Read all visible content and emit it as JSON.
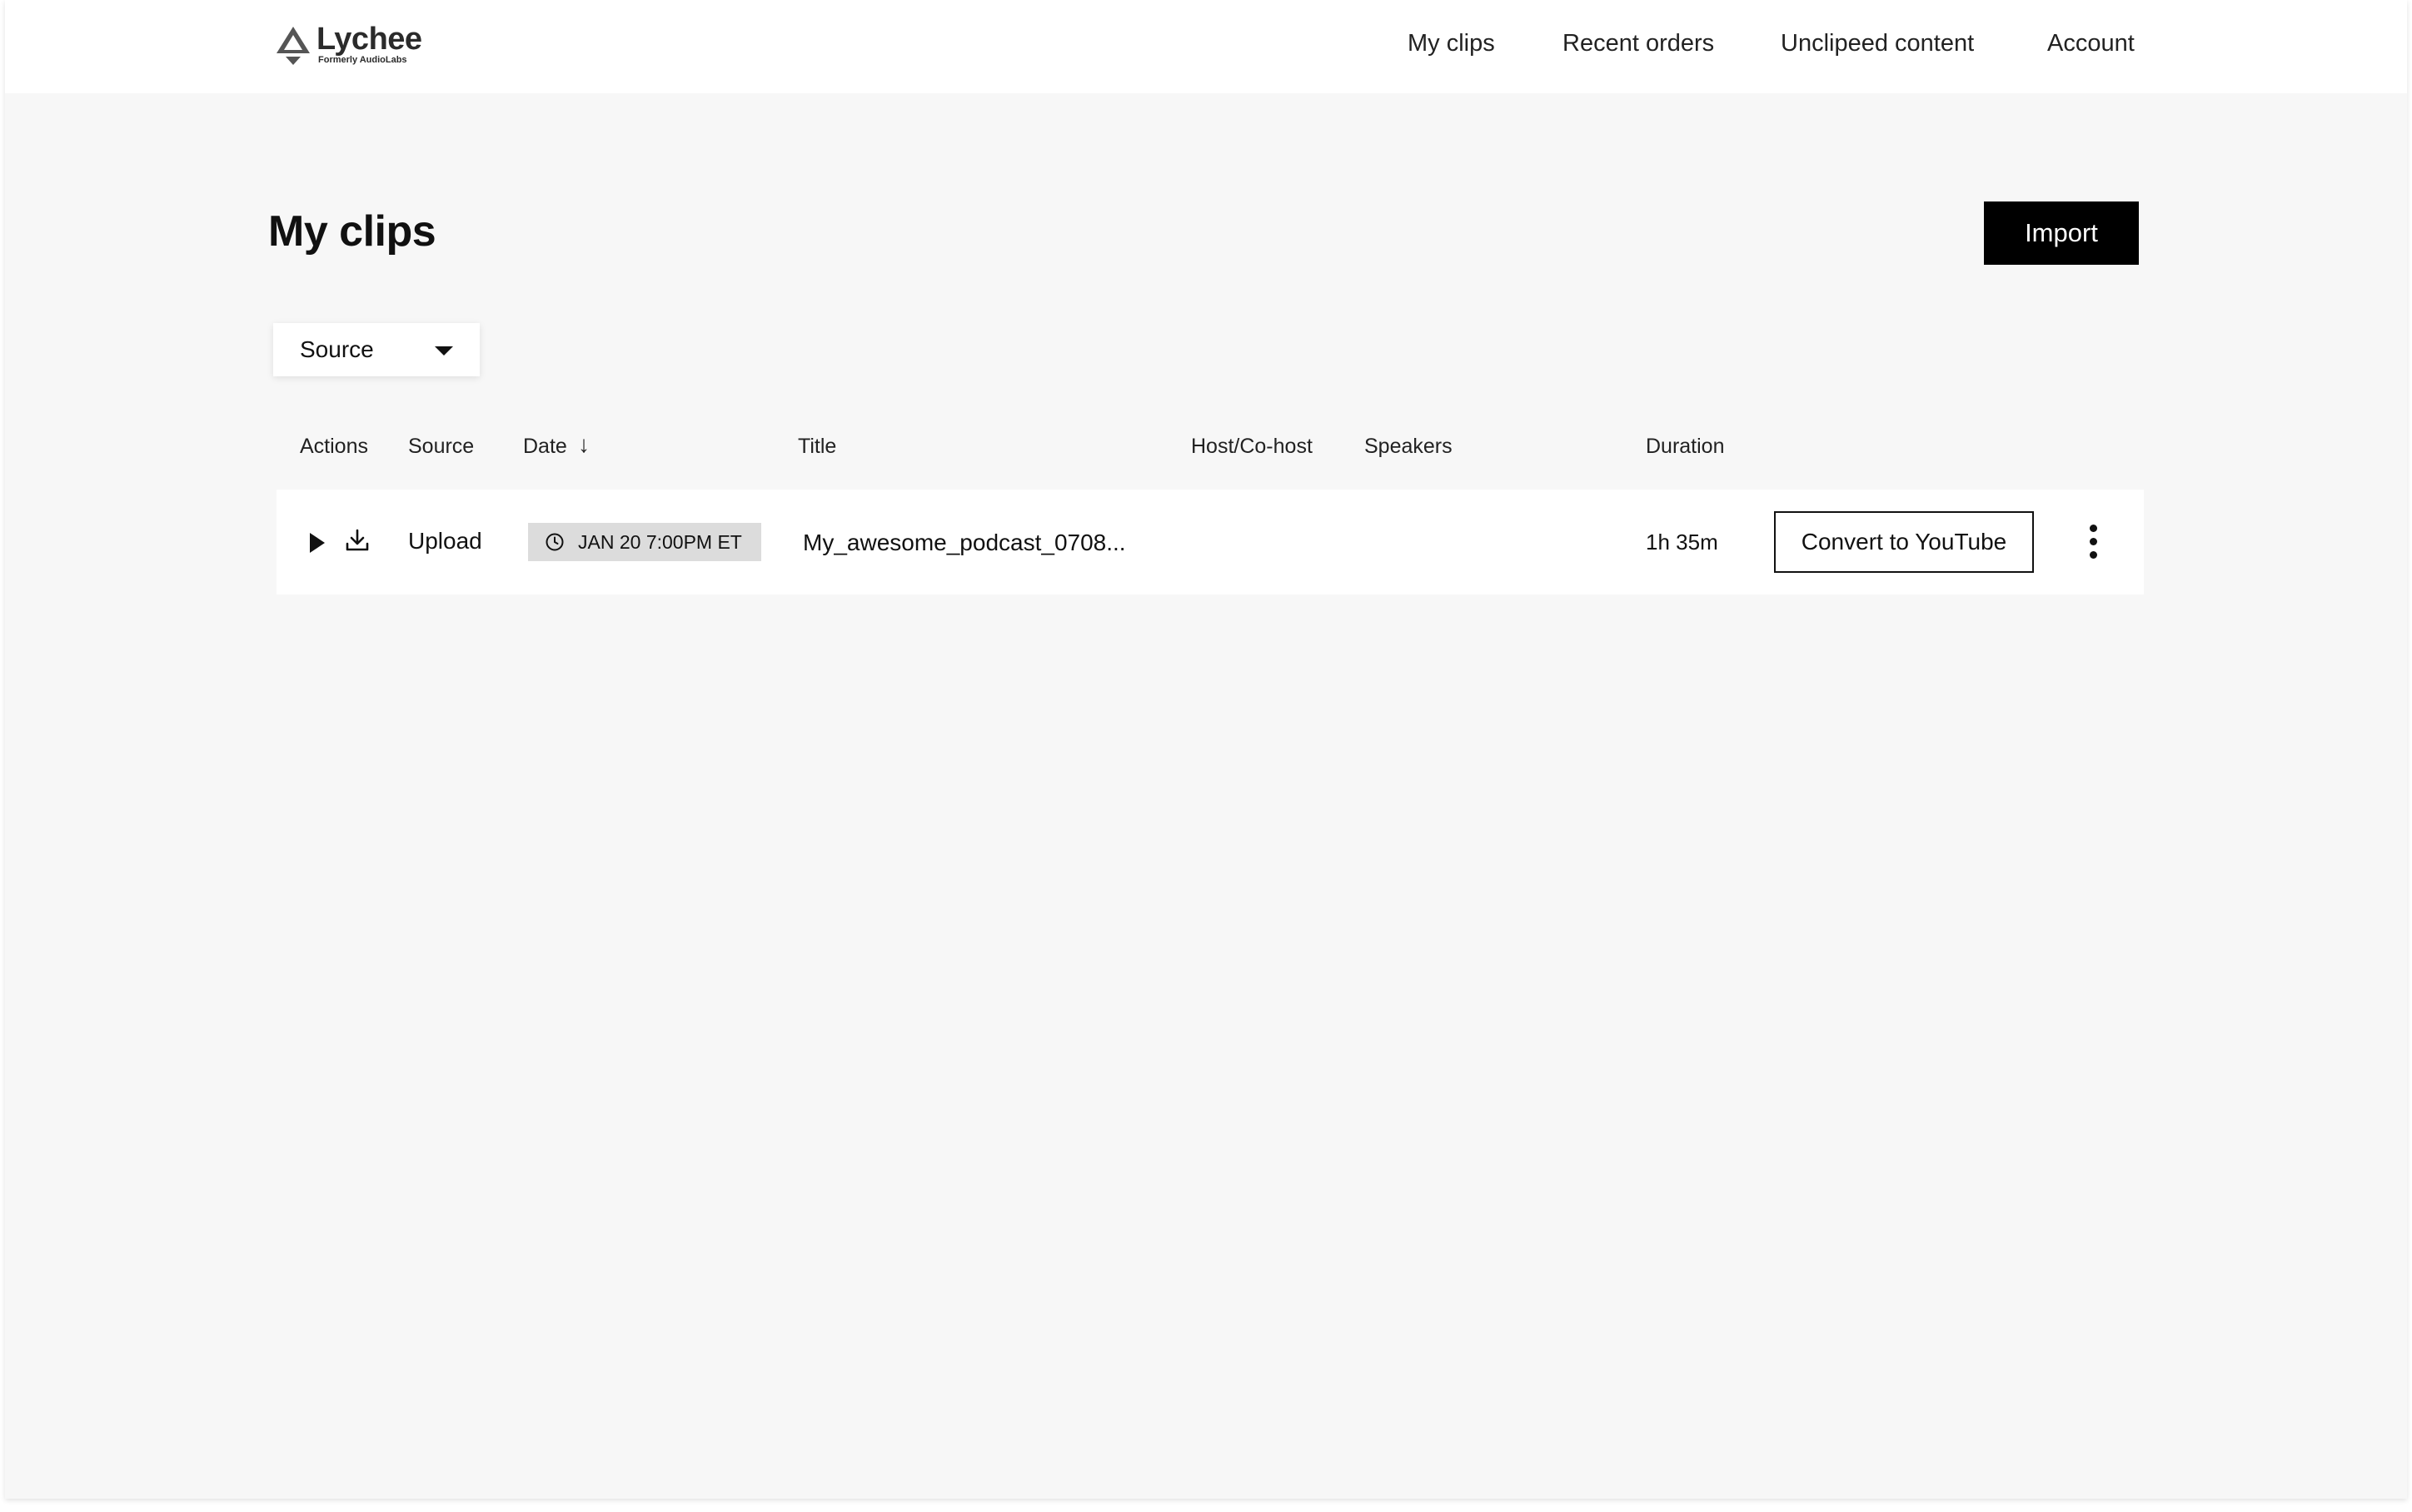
{
  "brand": {
    "name": "Lychee",
    "tagline": "Formerly AudioLabs",
    "logo_icon": "triangle-logo-icon"
  },
  "nav": {
    "items": [
      {
        "label": "My clips"
      },
      {
        "label": "Recent orders"
      },
      {
        "label": "Unclipeed content"
      },
      {
        "label": "Account"
      }
    ]
  },
  "page": {
    "title": "My clips",
    "import_label": "Import"
  },
  "filter": {
    "source_label": "Source",
    "icon": "caret-down-icon"
  },
  "table": {
    "columns": [
      {
        "label": "Actions"
      },
      {
        "label": "Source"
      },
      {
        "label": "Date"
      },
      {
        "label": "Title"
      },
      {
        "label": "Host/Co-host"
      },
      {
        "label": "Speakers"
      },
      {
        "label": "Duration"
      }
    ],
    "sort_icon": "arrow-down-icon",
    "rows": [
      {
        "source": "Upload",
        "date": "JAN 20 7:00PM ET",
        "title": "My_awesome_podcast_0708...",
        "host": "",
        "speakers": "",
        "duration": "1h 35m",
        "action_label": "Convert to YouTube"
      }
    ]
  },
  "colors": {
    "background": "#f7f7f7",
    "surface": "#ffffff",
    "primary": "#000000",
    "badge": "#dcdcdc",
    "text": "#111111"
  }
}
